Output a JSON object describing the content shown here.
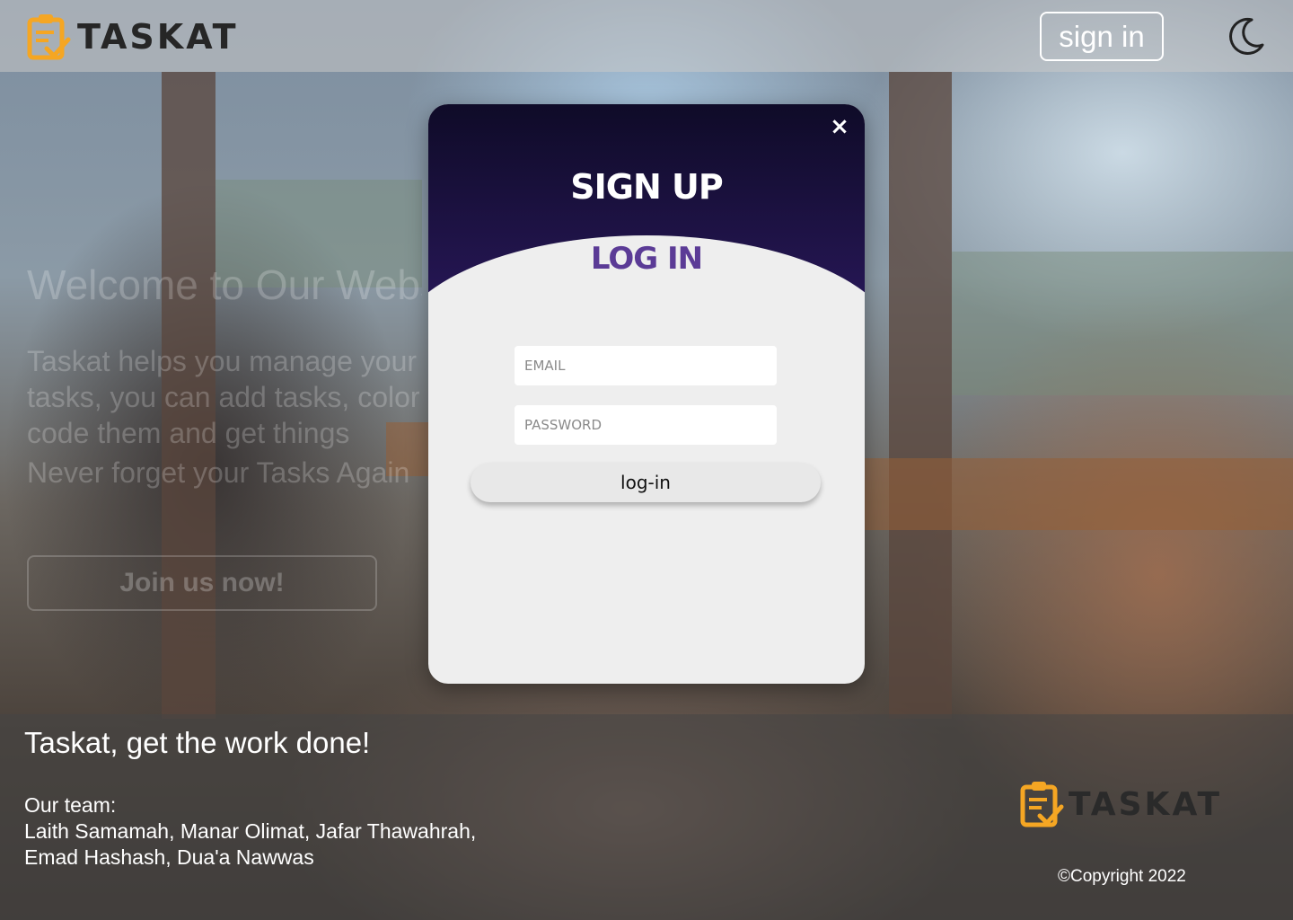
{
  "header": {
    "brand_name": "TASKAT",
    "signin_label": "sign in",
    "theme_icon": "moon-icon"
  },
  "hero": {
    "title": "Welcome to Our Website",
    "description": "Taskat helps you manage your tasks, you can add tasks, color code them and get things done.",
    "subtitle": "Never forget your Tasks Again",
    "cta_label": "Join us now!"
  },
  "modal": {
    "close_label": "×",
    "signup_tab": "SIGN UP",
    "login_tab": "LOG IN",
    "email_placeholder": "EMAIL",
    "password_placeholder": "PASSWORD",
    "login_button": "log-in"
  },
  "footer": {
    "tagline": "Taskat, get the work done!",
    "team_label": "Our team:",
    "team_line1": "Laith Samamah, Manar Olimat, Jafar Thawahrah,",
    "team_line2": "Emad Hashash, Dua'a Nawwas",
    "brand_name": "TASKAT",
    "copyright": "©Copyright 2022"
  },
  "colors": {
    "brand_orange": "#f5a623",
    "modal_dark": "#1a1140",
    "login_purple": "#5b3b96"
  }
}
